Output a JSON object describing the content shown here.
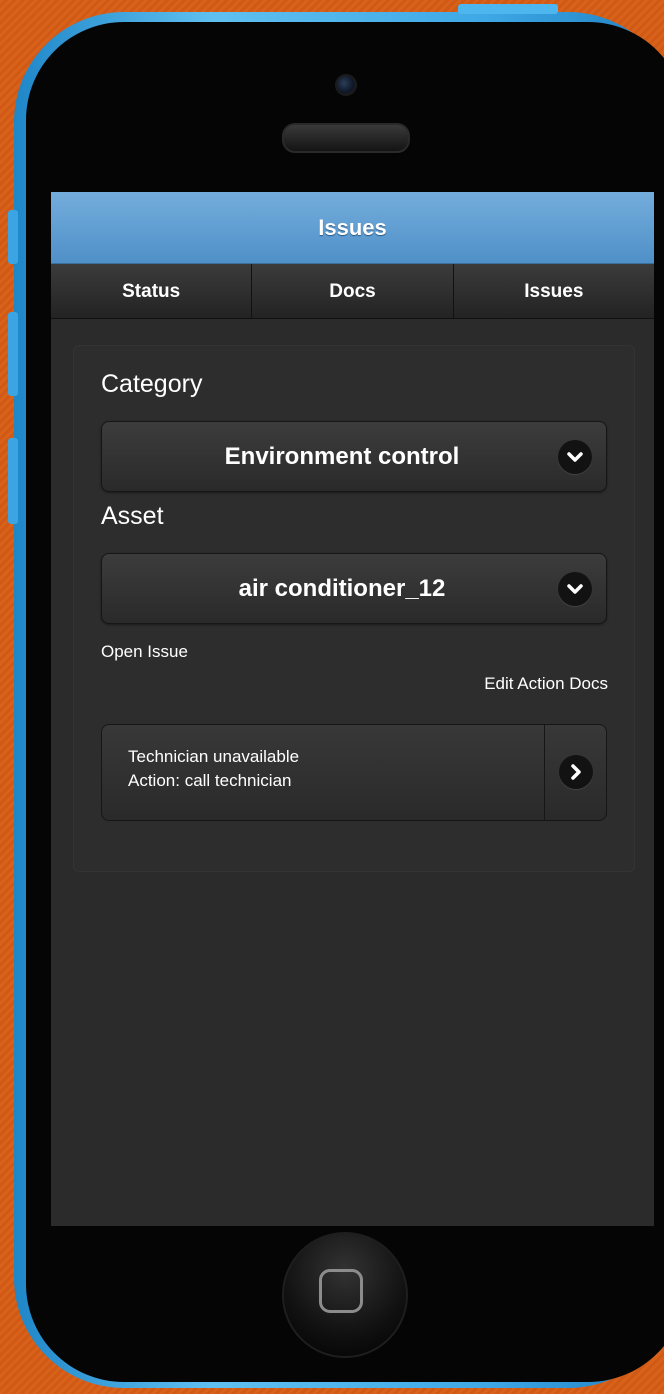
{
  "header": {
    "title": "Issues"
  },
  "tabs": [
    {
      "label": "Status"
    },
    {
      "label": "Docs"
    },
    {
      "label": "Issues"
    }
  ],
  "form": {
    "category": {
      "label": "Category",
      "value": "Environment control"
    },
    "asset": {
      "label": "Asset",
      "value": "air conditioner_12"
    },
    "open_issue_label": "Open Issue",
    "edit_action_docs_label": "Edit Action Docs"
  },
  "issues_list": [
    {
      "line1": "Technician unavailable",
      "line2": "Action: call technician"
    }
  ],
  "colors": {
    "background": "#d8621a",
    "phone_frame": "#3fa9e6",
    "header": "#5f9ed3",
    "screen": "#2b2b2b",
    "text": "#ffffff"
  },
  "icons": {
    "category_select": "chevron-down-icon",
    "asset_select": "chevron-down-icon",
    "list_item": "chevron-right-icon"
  }
}
